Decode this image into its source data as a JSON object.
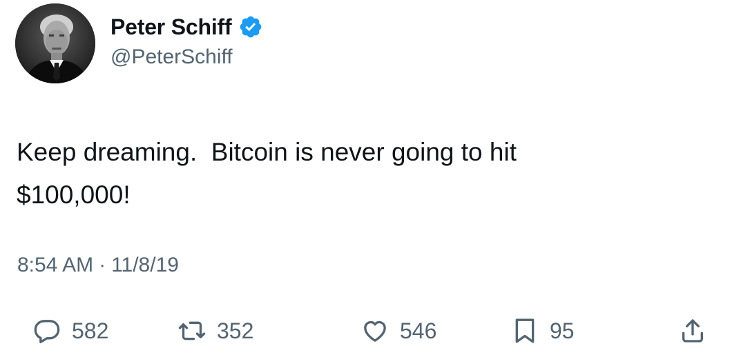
{
  "author": {
    "display_name": "Peter Schiff",
    "handle": "@PeterSchiff",
    "verified": true,
    "avatar_icon": "avatar-photo",
    "badge_color": "#1d9bf0"
  },
  "tweet": {
    "text": "Keep dreaming.  Bitcoin is never going to hit\n$100,000!",
    "time": "8:54 AM",
    "separator": "·",
    "date": "11/8/19"
  },
  "actions": {
    "reply": {
      "icon": "reply-icon",
      "count": "582"
    },
    "retweet": {
      "icon": "retweet-icon",
      "count": "352"
    },
    "like": {
      "icon": "heart-icon",
      "count": "546"
    },
    "bookmark": {
      "icon": "bookmark-icon",
      "count": "95"
    },
    "share": {
      "icon": "share-icon"
    }
  },
  "colors": {
    "text_primary": "#0f1419",
    "text_secondary": "#536471",
    "verified_blue": "#1d9bf0",
    "background": "#ffffff"
  }
}
